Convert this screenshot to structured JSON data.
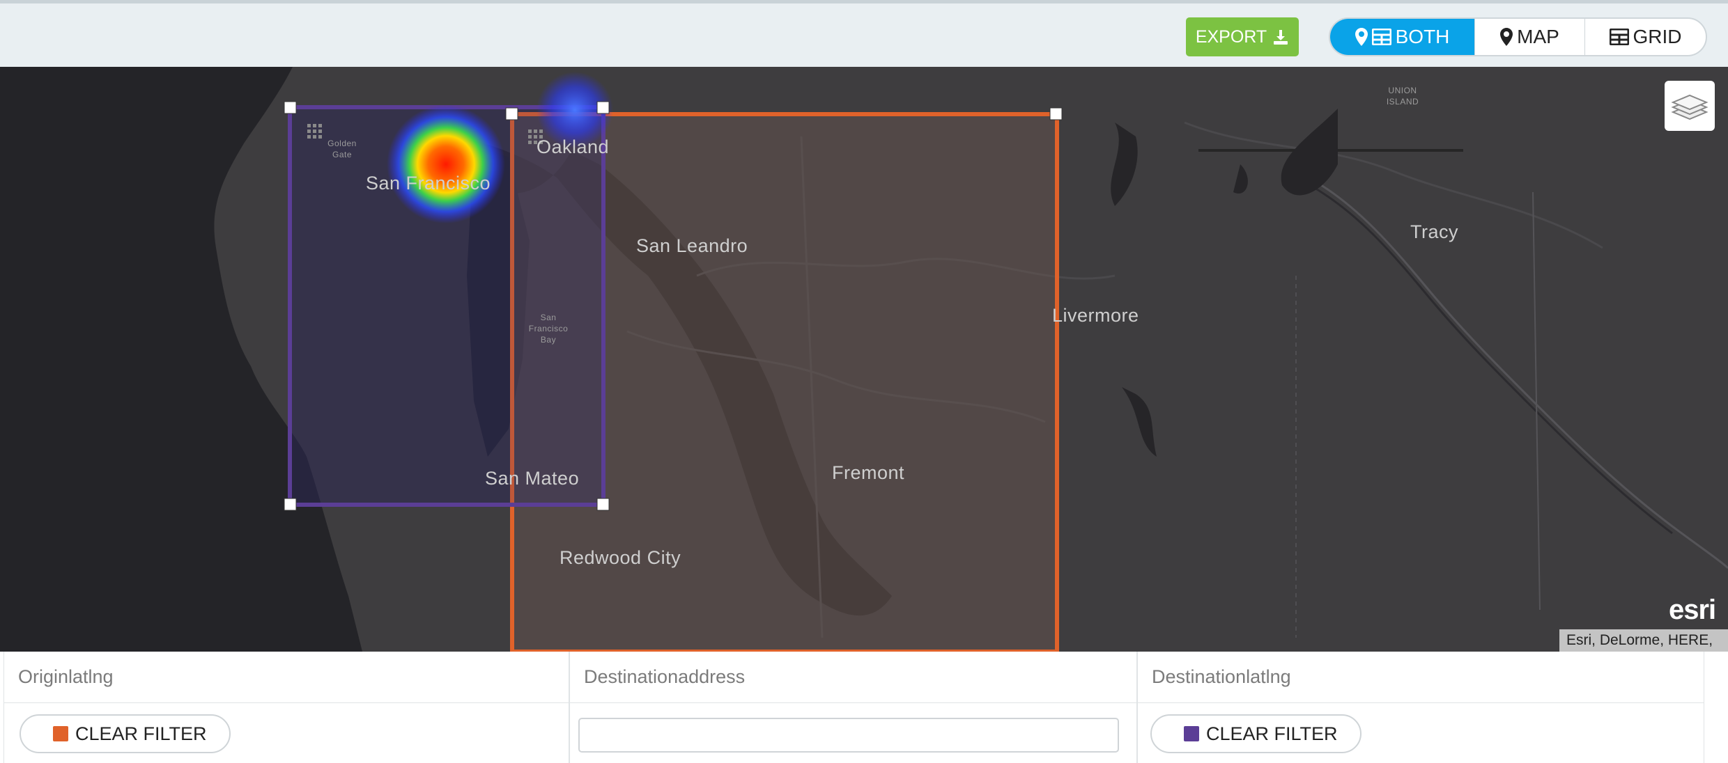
{
  "toolbar": {
    "export_label": "EXPORT",
    "views": [
      {
        "label": "BOTH",
        "active": true
      },
      {
        "label": "MAP",
        "active": false
      },
      {
        "label": "GRID",
        "active": false
      }
    ]
  },
  "map": {
    "labels": {
      "oakland": "Oakland",
      "san_francisco": "San Francisco",
      "san_leandro": "San Leandro",
      "livermore": "Livermore",
      "tracy": "Tracy",
      "fremont": "Fremont",
      "san_mateo": "San Mateo",
      "redwood_city": "Redwood City",
      "union_island": "UNION ISLAND",
      "golden_gate": "Golden Gate",
      "sf_bay": "San Francisco Bay"
    },
    "logo": "esri",
    "attribution": "Esri, DeLorme, HERE,",
    "filter_colors": {
      "origin": "#e0622a",
      "destination": "#5b3e96"
    }
  },
  "grid": {
    "columns": [
      {
        "header": "Originlatlng",
        "button": "CLEAR FILTER"
      },
      {
        "header": "Destinationaddress",
        "input_value": ""
      },
      {
        "header": "Destinationlatlng",
        "button": "CLEAR FILTER"
      }
    ]
  }
}
